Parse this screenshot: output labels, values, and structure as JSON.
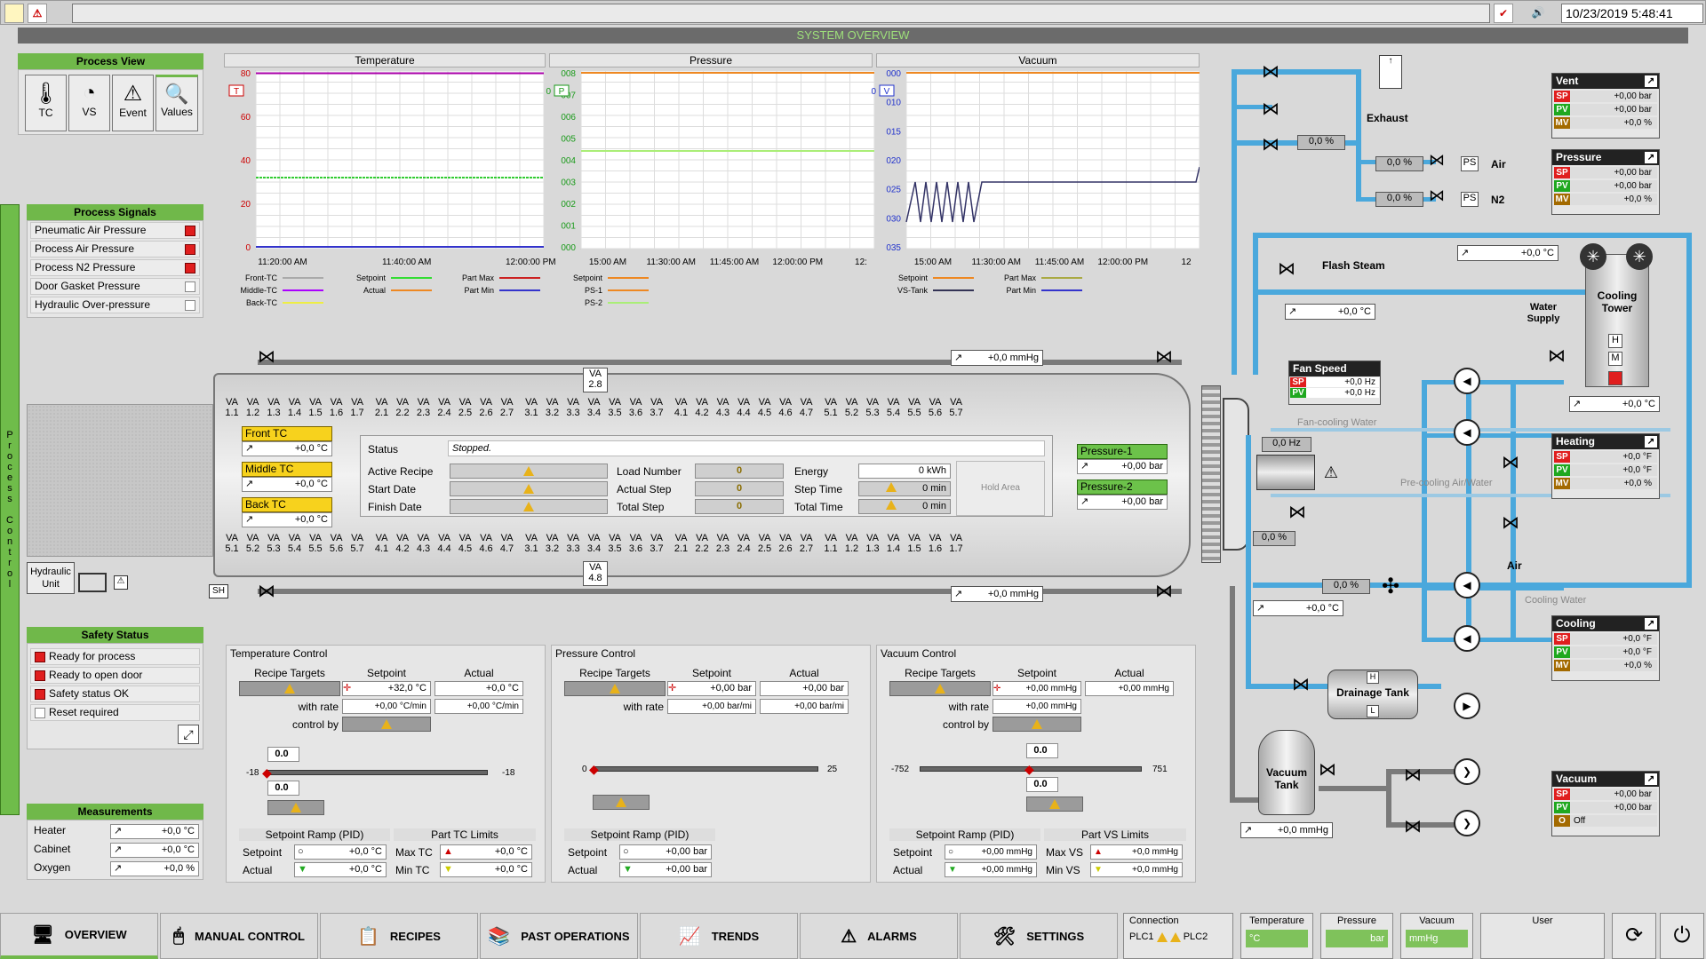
{
  "topbar": {
    "datetime": "10/23/2019 5:48:41"
  },
  "title": "SYSTEM OVERVIEW",
  "process_view": {
    "title": "Process View",
    "buttons": [
      "TC",
      "VS",
      "Event",
      "Values"
    ]
  },
  "charts": {
    "temperature": {
      "title": "Temperature",
      "yticks": [
        "80",
        "60",
        "40",
        "20",
        "0"
      ],
      "xticks": [
        "11:20:00 AM",
        "11:40:00 AM",
        "12:00:00 PM"
      ],
      "btn": "T",
      "legend": [
        "Front-TC",
        "Middle-TC",
        "Back-TC",
        "Setpoint",
        "Actual",
        "Part Max",
        "Part Min"
      ]
    },
    "pressure": {
      "title": "Pressure",
      "yticks": [
        "008",
        "007",
        "006",
        "005",
        "004",
        "003",
        "002",
        "001",
        "000"
      ],
      "xticks": [
        "15:00 AM",
        "11:30:00 AM",
        "11:45:00 AM",
        "12:00:00 PM",
        "12:"
      ],
      "btn": "P",
      "first_tick": "0",
      "legend": [
        "Setpoint",
        "PS-1",
        "PS-2"
      ]
    },
    "vacuum": {
      "title": "Vacuum",
      "yticks": [
        "000",
        "010",
        "015",
        "020",
        "025",
        "030",
        "035"
      ],
      "xticks": [
        "15:00 AM",
        "11:30:00 AM",
        "11:45:00 AM",
        "12:00:00 PM",
        "12"
      ],
      "btn": "V",
      "first_tick": "0",
      "legend": [
        "Setpoint",
        "VS-Tank",
        "Part Max",
        "Part Min"
      ]
    }
  },
  "chart_data": [
    {
      "type": "line",
      "title": "Temperature",
      "ylim": [
        0,
        80
      ],
      "series": [
        {
          "name": "Setpoint",
          "values": [
            32,
            32,
            32,
            32,
            32,
            32
          ]
        },
        {
          "name": "Part Max",
          "values": [
            79,
            79,
            79,
            79,
            79,
            79
          ]
        }
      ]
    },
    {
      "type": "line",
      "title": "Pressure",
      "series": [
        {
          "name": "Setpoint",
          "values": [
            0.004,
            0.004,
            0.004,
            0.004
          ]
        }
      ]
    },
    {
      "type": "line",
      "title": "Vacuum",
      "series": [
        {
          "name": "VS-Tank",
          "values": [
            0.03,
            0.03,
            0.03,
            0.03
          ]
        }
      ]
    }
  ],
  "process_signals": {
    "title": "Process Signals",
    "items": [
      {
        "label": "Pneumatic Air Pressure",
        "state": "red"
      },
      {
        "label": "Process Air Pressure",
        "state": "red"
      },
      {
        "label": "Process N2 Pressure",
        "state": "red"
      },
      {
        "label": "Door Gasket Pressure",
        "state": "white"
      },
      {
        "label": "Hydraulic Over-pressure",
        "state": "white"
      }
    ]
  },
  "side_tab": "Process Control",
  "hydraulic": "Hydraulic Unit",
  "sh": "SH",
  "safety": {
    "title": "Safety Status",
    "items": [
      {
        "label": "Ready for process",
        "state": "red"
      },
      {
        "label": "Ready to open door",
        "state": "red"
      },
      {
        "label": "Safety status OK",
        "state": "red"
      },
      {
        "label": "Reset required",
        "state": "white"
      }
    ]
  },
  "measurements": {
    "title": "Measurements",
    "items": [
      {
        "label": "Heater",
        "value": "+0,0 °C"
      },
      {
        "label": "Cabinet",
        "value": "+0,0 °C"
      },
      {
        "label": "Oxygen",
        "value": "+0,0 %"
      }
    ]
  },
  "autoclave": {
    "top_row": [
      "1.1",
      "1.2",
      "1.3",
      "1.4",
      "1.5",
      "1.6",
      "1.7",
      "2.1",
      "2.2",
      "2.3",
      "2.4",
      "2.5",
      "2.6",
      "2.7",
      "3.1",
      "3.2",
      "3.3",
      "3.4",
      "3.5",
      "3.6",
      "3.7",
      "4.1",
      "4.2",
      "4.3",
      "4.4",
      "4.5",
      "4.6",
      "4.7",
      "5.1",
      "5.2",
      "5.3",
      "5.4",
      "5.5",
      "5.6",
      "5.7"
    ],
    "bottom_row": [
      "5.1",
      "5.2",
      "5.3",
      "5.4",
      "5.5",
      "5.6",
      "5.7",
      "4.1",
      "4.2",
      "4.3",
      "4.4",
      "4.5",
      "4.6",
      "4.7",
      "3.1",
      "3.2",
      "3.3",
      "3.4",
      "3.5",
      "3.6",
      "3.7",
      "2.1",
      "2.2",
      "2.3",
      "2.4",
      "2.5",
      "2.6",
      "2.7",
      "1.1",
      "1.2",
      "1.3",
      "1.4",
      "1.5",
      "1.6",
      "1.7"
    ],
    "va": "VA",
    "top_extra": "2.8",
    "bottom_extra": "4.8",
    "front_tc": {
      "label": "Front TC",
      "value": "+0,0 °C"
    },
    "middle_tc": {
      "label": "Middle TC",
      "value": "+0,0 °C"
    },
    "back_tc": {
      "label": "Back TC",
      "value": "+0,0 °C"
    },
    "pressure1": {
      "label": "Pressure-1",
      "value": "+0,00 bar"
    },
    "pressure2": {
      "label": "Pressure-2",
      "value": "+0,00 bar"
    },
    "status_label": "Status",
    "status_value": "Stopped.",
    "active_recipe": "Active Recipe",
    "start_date": "Start Date",
    "finish_date": "Finish Date",
    "load_number": "Load Number",
    "actual_step": "Actual Step",
    "total_step": "Total Step",
    "zero": "0",
    "energy": "Energy",
    "energy_val": "0 kWh",
    "step_time": "Step Time",
    "step_time_val": "0 min",
    "total_time": "Total Time",
    "total_time_val": "0 min",
    "hold_area": "Hold Area",
    "vac_top": "+0,0 mmHg",
    "vac_bottom": "+0,0 mmHg"
  },
  "temp_control": {
    "title": "Temperature Control",
    "recipe_targets": "Recipe Targets",
    "setpoint": "Setpoint",
    "actual": "Actual",
    "sp_val": "+32,0 °C",
    "act_val": "+0,0 °C",
    "with_rate": "with rate",
    "rate_sp": "+0,00 °C/min",
    "rate_act": "+0,00 °C/min",
    "control_by": "control by",
    "slider_top": "0.0",
    "slider_bot": "0.0",
    "min": "-18",
    "max": "-18",
    "ramp": "Setpoint Ramp (PID)",
    "limits": "Part TC Limits",
    "r_sp": "Setpoint",
    "r_act": "Actual",
    "r_sp_v": "+0,0 °C",
    "r_act_v": "+0,0 °C",
    "max_l": "Max TC",
    "min_l": "Min TC",
    "max_v": "+0,0 °C",
    "min_v": "+0,0 °C"
  },
  "press_control": {
    "title": "Pressure Control",
    "recipe_targets": "Recipe Targets",
    "setpoint": "Setpoint",
    "actual": "Actual",
    "sp_val": "+0,00 bar",
    "act_val": "+0,00 bar",
    "with_rate": "with rate",
    "rate_sp": "+0,00 bar/mi",
    "rate_act": "+0,00 bar/mi",
    "min": "0",
    "max": "25",
    "ramp": "Setpoint Ramp (PID)",
    "r_sp": "Setpoint",
    "r_act": "Actual",
    "r_sp_v": "+0,00 bar",
    "r_act_v": "+0,00 bar"
  },
  "vac_control": {
    "title": "Vacuum Control",
    "recipe_targets": "Recipe Targets",
    "setpoint": "Setpoint",
    "actual": "Actual",
    "sp_val": "+0,00 mmHg",
    "act_val": "+0,00 mmHg",
    "with_rate": "with rate",
    "rate_sp": "+0,00 mmHg",
    "control_by": "control by",
    "slider_top": "0.0",
    "slider_bot": "0.0",
    "min": "-752",
    "max": "751",
    "ramp": "Setpoint Ramp (PID)",
    "limits": "Part VS Limits",
    "r_sp": "Setpoint",
    "r_act": "Actual",
    "r_sp_v": "+0,00 mmHg",
    "r_act_v": "+0,00 mmHg",
    "max_l": "Max VS",
    "min_l": "Min VS",
    "max_v": "+0,0 mmHg",
    "min_v": "+0,0 mmHg"
  },
  "piping": {
    "exhaust": "Exhaust",
    "air": "Air",
    "n2": "N2",
    "ps": "PS",
    "valve_pct1": "0,0",
    "valve_pct2": "0,0",
    "valve_pct3": "0,0",
    "pct": "%",
    "flash_steam": "Flash Steam",
    "flash_val": "+0,0 °C",
    "top_temp": "+0,0 °C",
    "water_supply": "Water Supply",
    "cooling_tower": "Cooling Tower",
    "tower_val": "+0,0 °C",
    "fan_speed": "Fan Speed",
    "fan_sp": "+0,0 Hz",
    "fan_pv": "+0,0 Hz",
    "fan_cooling": "Fan-cooling Water",
    "motor_hz": "0,0",
    "hz": "Hz",
    "precooling": "Pre-cooling Air/Water",
    "air2": "Air",
    "v_pct4": "0,0",
    "v_pct5": "0,0",
    "mid_temp": "+0,0 °C",
    "cooling_water": "Cooling Water",
    "drainage": "Drainage Tank",
    "vacuum_tank": "Vacuum Tank",
    "vt_val": "+0,0 mmHg",
    "H": "H",
    "M": "M",
    "L": "L"
  },
  "loops": [
    {
      "name": "Vent",
      "sp": "+0,00 bar",
      "pv": "+0,00 bar",
      "mv": "+0,0 %"
    },
    {
      "name": "Pressure",
      "sp": "+0,00 bar",
      "pv": "+0,00 bar",
      "mv": "+0,0 %"
    },
    {
      "name": "Heating",
      "sp": "+0,0 °F",
      "pv": "+0,0 °F",
      "mv": "+0,0 %"
    },
    {
      "name": "Cooling",
      "sp": "+0,0 °F",
      "pv": "+0,0 °F",
      "mv": "+0,0 %"
    },
    {
      "name": "Vacuum",
      "sp": "+0,00 bar",
      "pv": "+0,00 bar",
      "mv": "Off"
    }
  ],
  "loop_tags": {
    "sp": "SP",
    "pv": "PV",
    "mv": "MV",
    "o": "O"
  },
  "nav": [
    "OVERVIEW",
    "MANUAL CONTROL",
    "RECIPES",
    "PAST OPERATIONS",
    "TRENDS",
    "ALARMS",
    "SETTINGS"
  ],
  "status": {
    "connection": "Connection",
    "plc1": "PLC1",
    "plc2": "PLC2",
    "temperature": "Temperature",
    "temp_unit": "°C",
    "pressure": "Pressure",
    "press_unit": "bar",
    "vacuum": "Vacuum",
    "vac_unit": "mmHg",
    "user": "User"
  }
}
